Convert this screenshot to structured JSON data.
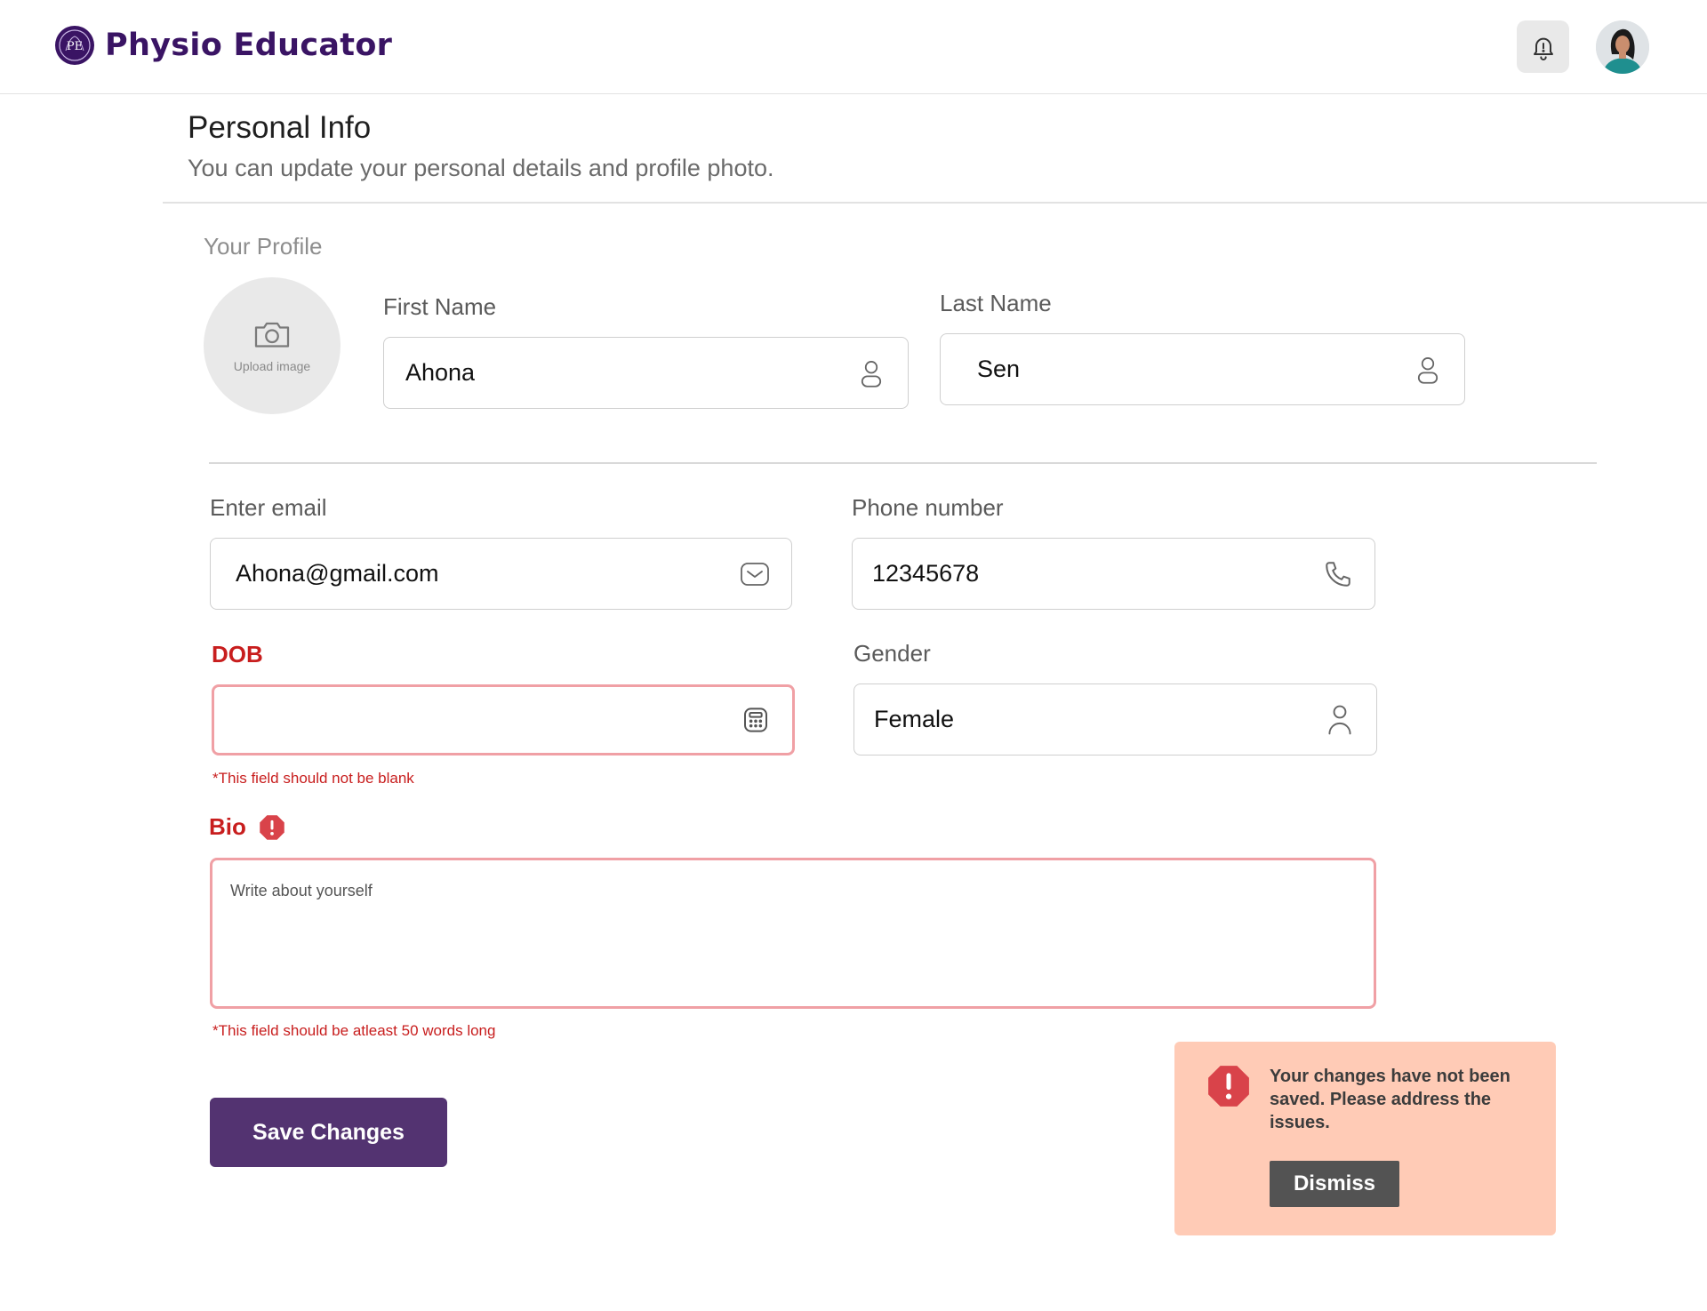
{
  "header": {
    "brand": "Physio Educator",
    "logo_initials": "PE"
  },
  "page": {
    "title": "Personal Info",
    "subtitle": "You can update your personal details and profile photo."
  },
  "profile": {
    "section_label": "Your Profile",
    "upload_label": "Upload image"
  },
  "fields": {
    "first_name": {
      "label": "First Name",
      "value": "Ahona"
    },
    "last_name": {
      "label": "Last Name",
      "value": "Sen"
    },
    "email": {
      "label": "Enter email",
      "value": "Ahona@gmail.com"
    },
    "phone": {
      "label": "Phone number",
      "value": "12345678"
    },
    "dob": {
      "label": "DOB",
      "value": "",
      "error": "*This field should not be blank"
    },
    "gender": {
      "label": "Gender",
      "value": "Female"
    },
    "bio": {
      "label": "Bio",
      "placeholder": "Write about yourself",
      "error": "*This field should be atleast 50 words long"
    }
  },
  "actions": {
    "save_label": "Save Changes"
  },
  "toast": {
    "message": "Your changes have not been saved. Please address the issues.",
    "dismiss_label": "Dismiss"
  },
  "colors": {
    "brand": "#3a1464",
    "primary_button": "#533371",
    "error": "#c81e1e",
    "error_border": "#f0a0a5",
    "toast_bg": "#ffcbb6",
    "dismiss_bg": "#535353"
  },
  "icons": {
    "logo": "logo-icon",
    "notification": "bell-icon",
    "upload": "camera-icon",
    "name": "user-icon",
    "email": "mail-icon",
    "phone": "phone-icon",
    "dob": "calendar-icon",
    "warning": "alert-octagon-icon"
  }
}
